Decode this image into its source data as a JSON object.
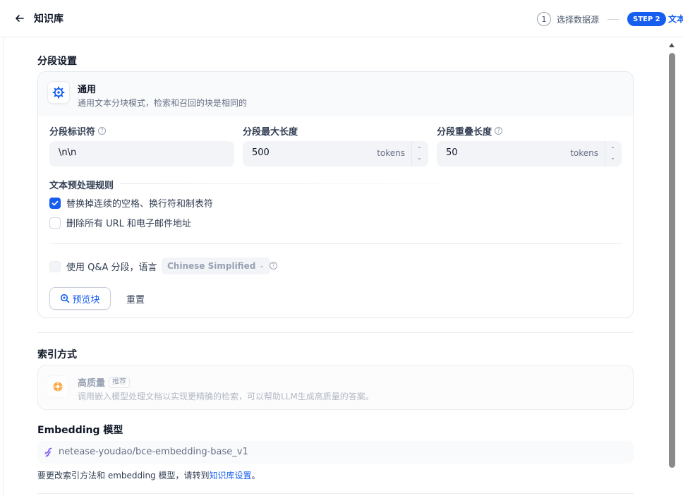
{
  "header": {
    "title": "知识库",
    "step1_number": "1",
    "step1_label": "选择数据源",
    "step2_badge": "STEP 2",
    "step2_label": "文本"
  },
  "segmentation": {
    "section_title": "分段设置",
    "mode_title": "通用",
    "mode_desc": "通用文本分块模式，检索和召回的块是相同的",
    "identifier": {
      "label": "分段标识符",
      "value": "\\n\\n"
    },
    "max_length": {
      "label": "分段最大长度",
      "value": "500",
      "unit": "tokens"
    },
    "overlap": {
      "label": "分段重叠长度",
      "value": "50",
      "unit": "tokens"
    },
    "preprocess_title": "文本预处理规则",
    "rules": [
      {
        "label": "替换掉连续的空格、换行符和制表符",
        "checked": true
      },
      {
        "label": "删除所有 URL 和电子邮件地址",
        "checked": false
      }
    ],
    "qa_label": "使用 Q&A 分段，语言",
    "qa_language": "Chinese Simplified",
    "preview_button": "预览块",
    "reset_button": "重置"
  },
  "index": {
    "section_title": "索引方式",
    "title": "高质量",
    "badge": "推荐",
    "desc": "调用嵌入模型处理文档以实现更精确的检索，可以帮助LLM生成高质量的答案。"
  },
  "embedding": {
    "section_title": "Embedding 模型",
    "model": "netease-youdao/bce-embedding-base_v1",
    "note_prefix": "要更改索引方法和 embedding 模型，请转到",
    "note_link": "知识库设置",
    "note_suffix": "。"
  },
  "colors": {
    "primary": "#155eef",
    "index_icon": "#f79009"
  }
}
